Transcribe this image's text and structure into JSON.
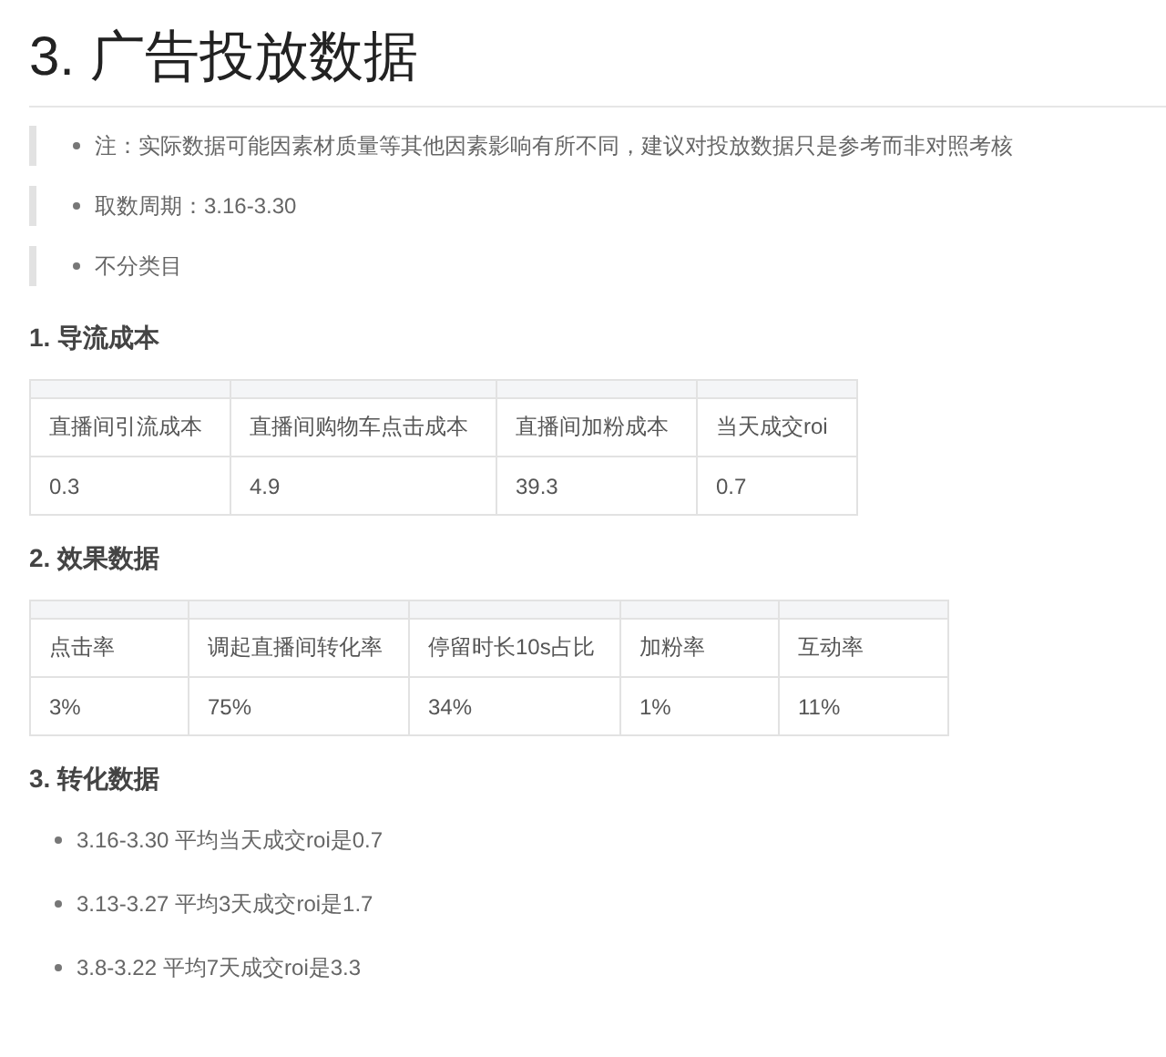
{
  "title": "3. 广告投放数据",
  "notes": [
    "注：实际数据可能因素材质量等其他因素影响有所不同，建议对投放数据只是参考而非对照考核",
    "取数周期：3.16-3.30",
    "不分类目"
  ],
  "sections": [
    {
      "heading": "1. 导流成本",
      "kind": "table",
      "columns": [
        "直播间引流成本",
        "直播间购物车点击成本",
        "直播间加粉成本",
        "当天成交roi"
      ],
      "rows": [
        [
          "0.3",
          "4.9",
          "39.3",
          "0.7"
        ]
      ]
    },
    {
      "heading": "2. 效果数据",
      "kind": "table",
      "columns": [
        "点击率",
        "调起直播间转化率",
        "停留时长10s占比",
        "加粉率",
        "互动率"
      ],
      "rows": [
        [
          "3%",
          "75%",
          "34%",
          "1%",
          "11%"
        ]
      ]
    },
    {
      "heading": "3. 转化数据",
      "kind": "list",
      "items": [
        "3.16-3.30 平均当天成交roi是0.7",
        "3.13-3.27 平均3天成交roi是1.7",
        "3.8-3.22 平均7天成交roi是3.3"
      ]
    }
  ]
}
